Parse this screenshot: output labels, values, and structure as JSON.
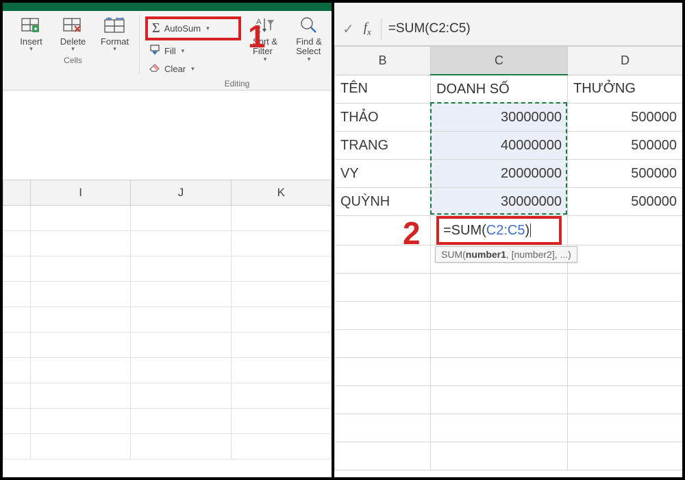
{
  "ribbon": {
    "cells_group_label": "Cells",
    "editing_group_label": "Editing",
    "insert": "Insert",
    "delete": "Delete",
    "format": "Format",
    "autosum": "AutoSum",
    "fill": "Fill",
    "clear": "Clear",
    "sort_filter_line1": "Sort &",
    "sort_filter_line2": "Filter",
    "find_select_line1": "Find &",
    "find_select_line2": "Select"
  },
  "callouts": {
    "one": "1",
    "two": "2"
  },
  "left_cols": {
    "i": "I",
    "j": "J",
    "k": "K"
  },
  "formula_bar": "=SUM(C2:C5)",
  "right_cols": {
    "b": "B",
    "c": "C",
    "d": "D"
  },
  "headers": {
    "b": "TÊN",
    "c": "DOANH SỐ",
    "d": "THƯỞNG"
  },
  "rows": [
    {
      "b": "THẢO",
      "c": "30000000",
      "d": "500000"
    },
    {
      "b": "TRANG",
      "c": "40000000",
      "d": "500000"
    },
    {
      "b": "VY",
      "c": "20000000",
      "d": "500000"
    },
    {
      "b": "QUỲNH",
      "c": "30000000",
      "d": "500000"
    }
  ],
  "active_formula": {
    "pre": "=SUM(",
    "arg": "C2:C5",
    "post": ")"
  },
  "tooltip": {
    "fn": "SUM(",
    "bold": "number1",
    "rest": ", [number2], ...)"
  }
}
